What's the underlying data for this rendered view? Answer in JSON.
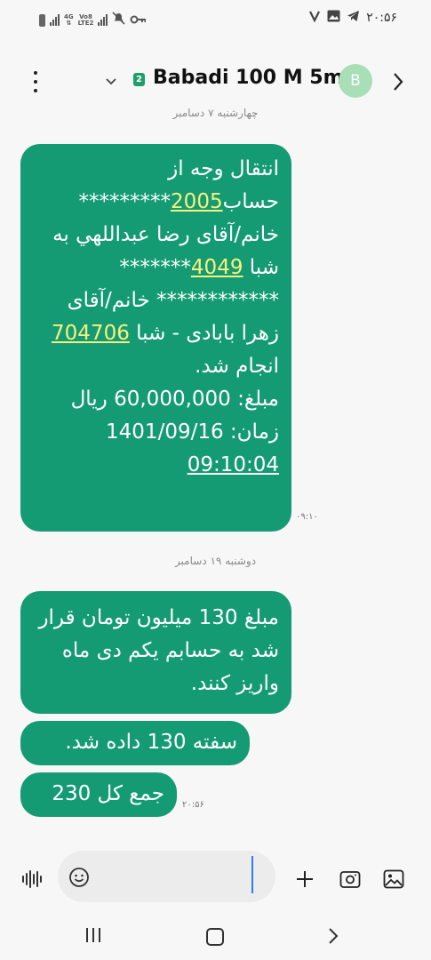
{
  "status_bar": {
    "network_label": "4G Vo8 LTE2",
    "time": "۲۰:۵۶",
    "icons": [
      "battery-icon",
      "signal-bars-icon",
      "network-badge-icon",
      "signal-bars-2-icon",
      "mute-icon",
      "key-icon",
      "check-icon",
      "image-icon",
      "telegram-icon"
    ]
  },
  "header": {
    "sim_number": "2",
    "contact_name": "Babadi 100 M 5m",
    "avatar_letter": "B"
  },
  "date_separators": [
    "چهارشنبه ۷ دسامبر",
    "دوشنبه ۱۹ دسامبر"
  ],
  "messages": [
    {
      "id": 1,
      "parts": {
        "p1": "انتقال وجه از حساب",
        "acct": "2005",
        "p2": "*********",
        "p3": " خانم/آقای رضا عبداللهي به شبا ",
        "sheba": "4049",
        "p4": "*******",
        "p5": "************ خانم/آقای زهرا بابادی - شبا ",
        "ref": "704706",
        "p6": " انجام شد.",
        "amount_label": "مبلغ: ",
        "amount": "60,000,000",
        "amount_unit": " ریال",
        "time_label": "زمان: ",
        "date": "1401/09/16",
        "clock": "09:10:04"
      },
      "time": "۰۹:۱۰"
    },
    {
      "id": 2,
      "text": "مبلغ 130 میلیون تومان قرار شد به حسابم یکم دی ماه واریز کنند."
    },
    {
      "id": 3,
      "text": "سفته 130 داده شد."
    },
    {
      "id": 4,
      "text": "جمع کل 230",
      "time": "۲۰:۵۶"
    }
  ],
  "input": {
    "placeholder": ""
  },
  "colors": {
    "bubble": "#159b73",
    "link": "#f8f17c",
    "avatar": "#a8dfb6",
    "cursor": "#2d7cf0"
  }
}
